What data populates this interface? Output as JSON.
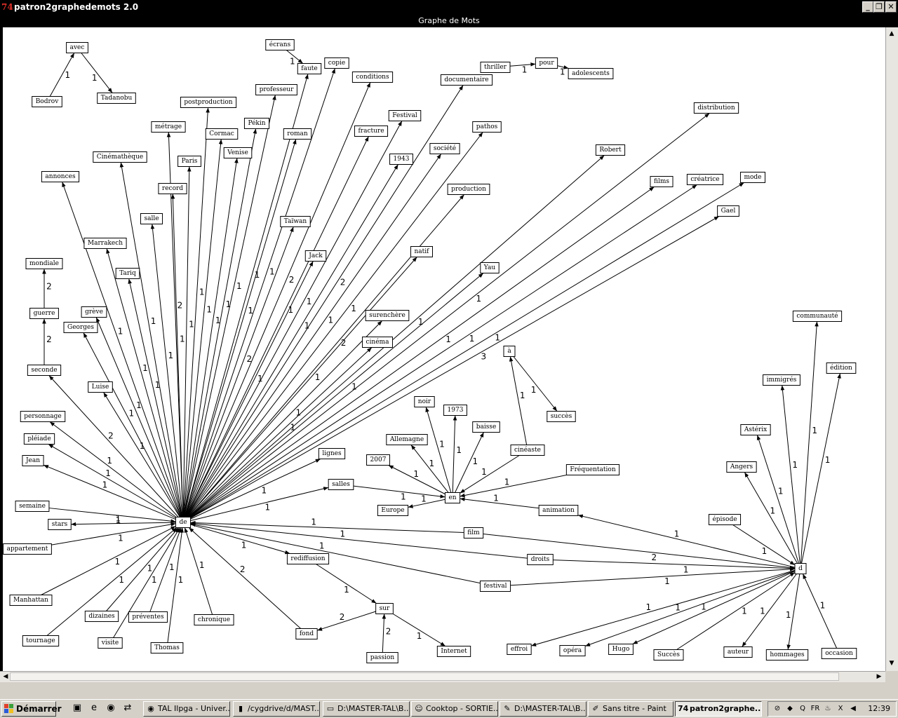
{
  "window": {
    "title": "patron2graphedemots 2.0",
    "app_icon": "74",
    "min_glyph": "_",
    "max_glyph": "❐",
    "close_glyph": "✕"
  },
  "panel": {
    "title": "Graphe de Mots"
  },
  "graph": {
    "nodes": [
      {
        "id": "avec",
        "label": "avec"
      },
      {
        "id": "bodrov",
        "label": "Bodrov"
      },
      {
        "id": "tadanobu",
        "label": "Tadanobu"
      },
      {
        "id": "ecrans",
        "label": "écrans"
      },
      {
        "id": "faute",
        "label": "faute"
      },
      {
        "id": "copie",
        "label": "copie"
      },
      {
        "id": "conditions",
        "label": "conditions"
      },
      {
        "id": "professeur",
        "label": "professeur"
      },
      {
        "id": "postproduction",
        "label": "postproduction"
      },
      {
        "id": "documentaire",
        "label": "documentaire"
      },
      {
        "id": "thriller",
        "label": "thriller"
      },
      {
        "id": "pour",
        "label": "pour"
      },
      {
        "id": "adolescents",
        "label": "adolescents"
      },
      {
        "id": "festival_cap",
        "label": "Festival"
      },
      {
        "id": "pekin",
        "label": "Pékin"
      },
      {
        "id": "metrage",
        "label": "métrage"
      },
      {
        "id": "cormac",
        "label": "Cormac"
      },
      {
        "id": "roman",
        "label": "roman"
      },
      {
        "id": "fracture",
        "label": "fracture"
      },
      {
        "id": "distribution",
        "label": "distribution"
      },
      {
        "id": "pathos",
        "label": "pathos"
      },
      {
        "id": "cinematheque",
        "label": "Cinémathèque"
      },
      {
        "id": "venise",
        "label": "Venise"
      },
      {
        "id": "paris",
        "label": "Paris"
      },
      {
        "id": "societe",
        "label": "société"
      },
      {
        "id": "y1943",
        "label": "1943"
      },
      {
        "id": "robert",
        "label": "Robert"
      },
      {
        "id": "annonces",
        "label": "annonces"
      },
      {
        "id": "record",
        "label": "record"
      },
      {
        "id": "creatrice",
        "label": "créatrice"
      },
      {
        "id": "films",
        "label": "films"
      },
      {
        "id": "mode",
        "label": "mode"
      },
      {
        "id": "production",
        "label": "production"
      },
      {
        "id": "gael",
        "label": "Gael"
      },
      {
        "id": "salle",
        "label": "salle"
      },
      {
        "id": "taiwan",
        "label": "Taïwan"
      },
      {
        "id": "marrakech",
        "label": "Marrakech"
      },
      {
        "id": "natif",
        "label": "natif"
      },
      {
        "id": "jack",
        "label": "Jack"
      },
      {
        "id": "mondiale",
        "label": "mondiale"
      },
      {
        "id": "yau",
        "label": "Yau"
      },
      {
        "id": "tariq",
        "label": "Tariq"
      },
      {
        "id": "greve",
        "label": "grève"
      },
      {
        "id": "guerre",
        "label": "guerre"
      },
      {
        "id": "surenchere",
        "label": "surenchère"
      },
      {
        "id": "communaute",
        "label": "communauté"
      },
      {
        "id": "georges",
        "label": "Georges"
      },
      {
        "id": "cinema",
        "label": "cinéma"
      },
      {
        "id": "a",
        "label": "à"
      },
      {
        "id": "seconde",
        "label": "seconde"
      },
      {
        "id": "edition",
        "label": "édition"
      },
      {
        "id": "immigres",
        "label": "immigrés"
      },
      {
        "id": "luise",
        "label": "Luise"
      },
      {
        "id": "noir",
        "label": "noir"
      },
      {
        "id": "y1973",
        "label": "1973"
      },
      {
        "id": "succes",
        "label": "succès"
      },
      {
        "id": "personnage",
        "label": "personnage"
      },
      {
        "id": "baisse",
        "label": "baisse"
      },
      {
        "id": "asterix",
        "label": "Astérix"
      },
      {
        "id": "pleiade",
        "label": "pléiade"
      },
      {
        "id": "allemagne",
        "label": "Allemagne"
      },
      {
        "id": "cineaste",
        "label": "cinéaste"
      },
      {
        "id": "lignes",
        "label": "lignes"
      },
      {
        "id": "y2007",
        "label": "2007"
      },
      {
        "id": "jean",
        "label": "Jean"
      },
      {
        "id": "angers",
        "label": "Angers"
      },
      {
        "id": "frequentation",
        "label": "Fréquentation"
      },
      {
        "id": "salles",
        "label": "salles"
      },
      {
        "id": "en",
        "label": "en"
      },
      {
        "id": "semaine",
        "label": "semaine"
      },
      {
        "id": "europe",
        "label": "Europe"
      },
      {
        "id": "animation",
        "label": "animation"
      },
      {
        "id": "de",
        "label": "de"
      },
      {
        "id": "stars",
        "label": "stars"
      },
      {
        "id": "episode",
        "label": "épisode"
      },
      {
        "id": "film",
        "label": "film"
      },
      {
        "id": "appartement",
        "label": "appartement"
      },
      {
        "id": "rediffusion",
        "label": "rediffusion"
      },
      {
        "id": "droits",
        "label": "droits"
      },
      {
        "id": "d",
        "label": "d"
      },
      {
        "id": "festival",
        "label": "festival"
      },
      {
        "id": "manhattan",
        "label": "Manhattan"
      },
      {
        "id": "sur",
        "label": "sur"
      },
      {
        "id": "dizaines",
        "label": "dizaines"
      },
      {
        "id": "preventes",
        "label": "préventes"
      },
      {
        "id": "chronique",
        "label": "chronique"
      },
      {
        "id": "tournage",
        "label": "tournage"
      },
      {
        "id": "visite",
        "label": "visite"
      },
      {
        "id": "fond",
        "label": "fond"
      },
      {
        "id": "internet",
        "label": "Internet"
      },
      {
        "id": "thomas",
        "label": "Thomas"
      },
      {
        "id": "effroi",
        "label": "effroi"
      },
      {
        "id": "opera",
        "label": "opéra"
      },
      {
        "id": "hugo",
        "label": "Hugo"
      },
      {
        "id": "succes2",
        "label": "Succès"
      },
      {
        "id": "auteur",
        "label": "auteur"
      },
      {
        "id": "hommages",
        "label": "hommages"
      },
      {
        "id": "occasion",
        "label": "occasion"
      },
      {
        "id": "passion",
        "label": "passion"
      }
    ],
    "edges": [
      {
        "from": "bodrov",
        "to": "avec",
        "w": "1"
      },
      {
        "from": "avec",
        "to": "tadanobu",
        "w": "1"
      },
      {
        "from": "ecrans",
        "to": "faute",
        "w": "1"
      },
      {
        "from": "thriller",
        "to": "pour",
        "w": "1"
      },
      {
        "from": "pour",
        "to": "adolescents",
        "w": "1"
      },
      {
        "from": "guerre",
        "to": "mondiale",
        "w": "2"
      },
      {
        "from": "seconde",
        "to": "guerre",
        "w": "2"
      },
      {
        "from": "de",
        "to": "annonces",
        "w": "1"
      },
      {
        "from": "de",
        "to": "cinematheque",
        "w": "1"
      },
      {
        "from": "de",
        "to": "metrage",
        "w": "2"
      },
      {
        "from": "de",
        "to": "postproduction",
        "w": "1"
      },
      {
        "from": "de",
        "to": "cormac",
        "w": "1"
      },
      {
        "from": "de",
        "to": "venise",
        "w": "1"
      },
      {
        "from": "de",
        "to": "pekin",
        "w": "1"
      },
      {
        "from": "de",
        "to": "professeur",
        "w": "1"
      },
      {
        "from": "de",
        "to": "faute",
        "w": "1"
      },
      {
        "from": "de",
        "to": "copie",
        "w": "1"
      },
      {
        "from": "de",
        "to": "conditions",
        "w": "2"
      },
      {
        "from": "de",
        "to": "roman",
        "w": "1"
      },
      {
        "from": "de",
        "to": "fracture",
        "w": "1"
      },
      {
        "from": "de",
        "to": "festival_cap",
        "w": "1"
      },
      {
        "from": "de",
        "to": "y1943",
        "w": "1"
      },
      {
        "from": "de",
        "to": "societe",
        "w": "1"
      },
      {
        "from": "de",
        "to": "pathos",
        "w": "1"
      },
      {
        "from": "de",
        "to": "documentaire",
        "w": "2"
      },
      {
        "from": "de",
        "to": "production",
        "w": "2"
      },
      {
        "from": "de",
        "to": "robert",
        "w": "1"
      },
      {
        "from": "de",
        "to": "distribution",
        "w": "1"
      },
      {
        "from": "de",
        "to": "films",
        "w": "1"
      },
      {
        "from": "de",
        "to": "creatrice",
        "w": "1"
      },
      {
        "from": "de",
        "to": "mode",
        "w": "1"
      },
      {
        "from": "de",
        "to": "gael",
        "w": "3"
      },
      {
        "from": "de",
        "to": "paris",
        "w": "1"
      },
      {
        "from": "de",
        "to": "record",
        "w": "1"
      },
      {
        "from": "de",
        "to": "salle",
        "w": "1"
      },
      {
        "from": "de",
        "to": "taiwan",
        "w": "2"
      },
      {
        "from": "de",
        "to": "jack",
        "w": "1"
      },
      {
        "from": "de",
        "to": "marrakech",
        "w": "1"
      },
      {
        "from": "de",
        "to": "tariq",
        "w": "1"
      },
      {
        "from": "de",
        "to": "natif",
        "w": "1"
      },
      {
        "from": "de",
        "to": "yau",
        "w": "1"
      },
      {
        "from": "de",
        "to": "greve",
        "w": "1"
      },
      {
        "from": "de",
        "to": "georges",
        "w": "1"
      },
      {
        "from": "de",
        "to": "surenchere",
        "w": "1"
      },
      {
        "from": "de",
        "to": "cinema",
        "w": "1"
      },
      {
        "from": "de",
        "to": "luise",
        "w": "1"
      },
      {
        "from": "de",
        "to": "seconde",
        "w": "2"
      },
      {
        "from": "de",
        "to": "personnage",
        "w": "1"
      },
      {
        "from": "de",
        "to": "pleiade",
        "w": "1"
      },
      {
        "from": "de",
        "to": "jean",
        "w": "1"
      },
      {
        "from": "de",
        "to": "lignes",
        "w": "1"
      },
      {
        "from": "de",
        "to": "salles",
        "w": "1"
      },
      {
        "from": "semaine",
        "to": "de",
        "w": "1"
      },
      {
        "from": "de",
        "to": "stars",
        "w": "1"
      },
      {
        "from": "appartement",
        "to": "de",
        "w": "1"
      },
      {
        "from": "manhattan",
        "to": "de",
        "w": "1"
      },
      {
        "from": "tournage",
        "to": "de",
        "w": "1"
      },
      {
        "from": "dizaines",
        "to": "de",
        "w": "1"
      },
      {
        "from": "visite",
        "to": "de",
        "w": "1"
      },
      {
        "from": "preventes",
        "to": "de",
        "w": "1"
      },
      {
        "from": "thomas",
        "to": "de",
        "w": "1"
      },
      {
        "from": "chronique",
        "to": "de",
        "w": "1"
      },
      {
        "from": "fond",
        "to": "de",
        "w": "2"
      },
      {
        "from": "de",
        "to": "rediffusion",
        "w": "1"
      },
      {
        "from": "film",
        "to": "de",
        "w": "1"
      },
      {
        "from": "droits",
        "to": "de",
        "w": "1"
      },
      {
        "from": "festival",
        "to": "de",
        "w": "1"
      },
      {
        "from": "salles",
        "to": "en",
        "w": "1"
      },
      {
        "from": "en",
        "to": "europe",
        "w": "1"
      },
      {
        "from": "en",
        "to": "y2007",
        "w": "1"
      },
      {
        "from": "en",
        "to": "allemagne",
        "w": "1"
      },
      {
        "from": "en",
        "to": "noir",
        "w": "1"
      },
      {
        "from": "en",
        "to": "y1973",
        "w": "1"
      },
      {
        "from": "en",
        "to": "baisse",
        "w": "1"
      },
      {
        "from": "cineaste",
        "to": "en",
        "w": "1"
      },
      {
        "from": "frequentation",
        "to": "en",
        "w": "1"
      },
      {
        "from": "animation",
        "to": "en",
        "w": "1"
      },
      {
        "from": "cineaste",
        "to": "a",
        "w": "1"
      },
      {
        "from": "a",
        "to": "succes",
        "w": "1"
      },
      {
        "from": "rediffusion",
        "to": "sur",
        "w": "1"
      },
      {
        "from": "sur",
        "to": "fond",
        "w": "2"
      },
      {
        "from": "sur",
        "to": "internet",
        "w": "1"
      },
      {
        "from": "passion",
        "to": "sur",
        "w": "2"
      },
      {
        "from": "d",
        "to": "communaute",
        "w": "1"
      },
      {
        "from": "d",
        "to": "edition",
        "w": "1"
      },
      {
        "from": "d",
        "to": "immigres",
        "w": "1"
      },
      {
        "from": "d",
        "to": "asterix",
        "w": "1"
      },
      {
        "from": "d",
        "to": "angers",
        "w": "1"
      },
      {
        "from": "episode",
        "to": "d",
        "w": "1"
      },
      {
        "from": "d",
        "to": "animation",
        "w": "1"
      },
      {
        "from": "film",
        "to": "d",
        "w": "2"
      },
      {
        "from": "droits",
        "to": "d",
        "w": "1"
      },
      {
        "from": "festival",
        "to": "d",
        "w": "1"
      },
      {
        "from": "d",
        "to": "effroi",
        "w": "1"
      },
      {
        "from": "d",
        "to": "opera",
        "w": "1"
      },
      {
        "from": "d",
        "to": "hugo",
        "w": "1"
      },
      {
        "from": "succes2",
        "to": "d",
        "w": "1"
      },
      {
        "from": "d",
        "to": "auteur",
        "w": "1"
      },
      {
        "from": "d",
        "to": "hommages",
        "w": "1"
      },
      {
        "from": "occasion",
        "to": "d",
        "w": "1"
      }
    ]
  },
  "taskbar": {
    "start_label": "Démarrer",
    "quicklaunch": [
      {
        "name": "show-desktop-icon",
        "glyph": "▣"
      },
      {
        "name": "internet-explorer-icon",
        "glyph": "e"
      },
      {
        "name": "firefox-icon",
        "glyph": "◉"
      },
      {
        "name": "network-icon",
        "glyph": "⇄"
      }
    ],
    "tasks": [
      {
        "name": "task-firefox",
        "icon": "◉",
        "label": "TAL Ilpga - Univer...",
        "active": false
      },
      {
        "name": "task-cygwin",
        "icon": "▮",
        "label": "/cygdrive/d/MAST...",
        "active": false
      },
      {
        "name": "task-explorer-1",
        "icon": "▭",
        "label": "D:\\MASTER-TAL\\B...",
        "active": false
      },
      {
        "name": "task-cooktop",
        "icon": "☺",
        "label": "Cooktop - SORTIE...",
        "active": false
      },
      {
        "name": "task-explorer-2",
        "icon": "✎",
        "label": "D:\\MASTER-TAL\\B...",
        "active": false
      },
      {
        "name": "task-paint",
        "icon": "✐",
        "label": "Sans titre - Paint",
        "active": false
      },
      {
        "name": "task-patron2graphedemots",
        "icon": "74",
        "label": "patron2graphe...",
        "active": true
      }
    ],
    "tray": [
      {
        "name": "security-icon",
        "glyph": "⊘"
      },
      {
        "name": "tool-icon",
        "glyph": "◆"
      },
      {
        "name": "search-tray-icon",
        "glyph": "Q"
      },
      {
        "name": "language-fr-icon",
        "glyph": "FR"
      },
      {
        "name": "java-icon",
        "glyph": "♨"
      },
      {
        "name": "x-icon",
        "glyph": "X"
      },
      {
        "name": "volume-icon",
        "glyph": "◀"
      }
    ],
    "clock": "12:39"
  },
  "colors": {
    "graph_bg": "#ffffff",
    "frame": "#000000",
    "edge": "#000000",
    "node_border": "#000000",
    "taskbar": "#d4d0c8"
  }
}
